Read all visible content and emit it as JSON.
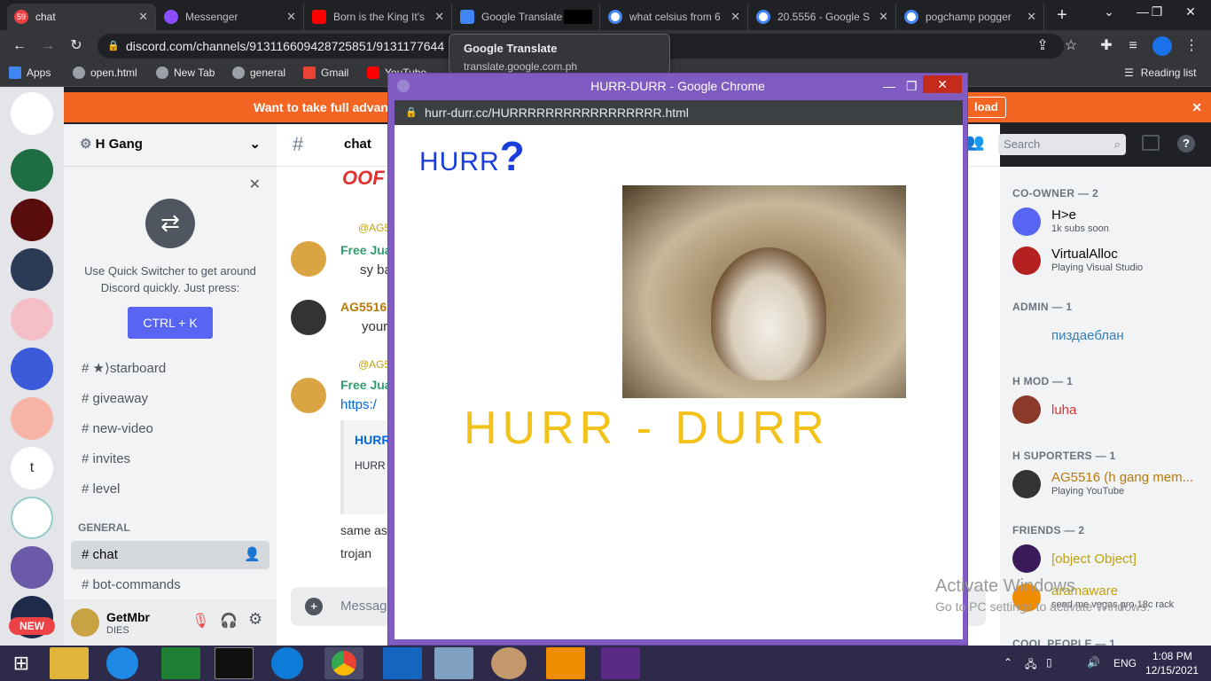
{
  "tabs": [
    {
      "label": "chat",
      "badge": "59",
      "color": "#ed4245"
    },
    {
      "label": "Messenger",
      "color": "#8a4dff"
    },
    {
      "label": "Born is the King It's",
      "color": "#ff0000"
    },
    {
      "label": "Google Translate",
      "color": "#4285f4"
    },
    {
      "label": "what celsius from 6",
      "color": "#4285f4"
    },
    {
      "label": "20.5556 - Google S",
      "color": "#4285f4"
    },
    {
      "label": "pogchamp pogger",
      "color": "#4285f4"
    }
  ],
  "url": "discord.com/channels/913116609428725851/9131177644",
  "bookmarks": [
    "Apps",
    "open.html",
    "New Tab",
    "general",
    "Gmail",
    "YouTube"
  ],
  "reading_list": "Reading list",
  "tooltip": {
    "title": "Google Translate",
    "url": "translate.google.com.ph"
  },
  "banner": {
    "text": "Want to take full advantage",
    "suffix": "load"
  },
  "server": {
    "name": "H Gang"
  },
  "quick_switcher": {
    "text1": "Use Quick Switcher to get around",
    "text2": "Discord quickly. Just press:",
    "shortcut": "CTRL + K"
  },
  "channels": [
    {
      "name": "★⟩starboard"
    },
    {
      "name": "giveaway"
    },
    {
      "name": "new-video"
    },
    {
      "name": "invites"
    },
    {
      "name": "level"
    }
  ],
  "category": "GENERAL",
  "general_channels": [
    {
      "name": "chat"
    },
    {
      "name": "bot-commands"
    }
  ],
  "current_channel": "chat",
  "user": {
    "name": "GetMbr",
    "status": "DIES",
    "new_badge": "NEW"
  },
  "chat": {
    "messages": [
      {
        "reply": "@AG5",
        "author": "Free Jua",
        "text": "sy ba"
      },
      {
        "author": "AG5516",
        "text": "your"
      },
      {
        "reply": "@AG5",
        "author": "Free Jua",
        "link": "https:/",
        "embed_title": "HURR",
        "embed_desc": "HURR"
      },
      {
        "text": "same as"
      },
      {
        "text": "trojan"
      }
    ],
    "input_placeholder": "Messag"
  },
  "search_placeholder": "Search",
  "members": {
    "groups": [
      {
        "header": "CO-OWNER — 2"
      },
      {
        "header": "ADMIN — 1"
      },
      {
        "header": "H MOD — 1"
      },
      {
        "header": "H SUPORTERS — 1"
      },
      {
        "header": "FRIENDS — 2"
      },
      {
        "header": "COOL PEOPLE — 1"
      }
    ],
    "list": [
      {
        "name": "H>e",
        "sub": "1k subs soon",
        "color": "#060607"
      },
      {
        "name": "VirtualAlloc",
        "sub": "Playing Visual Studio",
        "color": "#060607"
      },
      {
        "name": "пиздаеблан",
        "sub": "",
        "color": "#2f7fc1"
      },
      {
        "name": "luha",
        "sub": "",
        "color": "#e03131"
      },
      {
        "name": "AG5516 (h gang mem...",
        "sub": "Playing YouTube",
        "color": "#b9790a"
      },
      {
        "name": "[object Object]",
        "sub": "",
        "color": "#c1a10a"
      },
      {
        "name": "aramaware",
        "sub": "send me vegas pro 18c rack",
        "color": "#c1a10a"
      }
    ]
  },
  "popup": {
    "window_title": "HURR-DURR - Google Chrome",
    "address": "hurr-durr.cc/HURRRRRRRRRRRRRRRRR.html",
    "heading": "HURR",
    "heading_mark": "?",
    "big_title": "HURR - DURR"
  },
  "watermark": {
    "line1": "Activate Windows",
    "line2": "Go to PC settings to activate Windows."
  },
  "tray": {
    "lang": "ENG",
    "time": "1:08 PM",
    "date": "12/15/2021"
  }
}
